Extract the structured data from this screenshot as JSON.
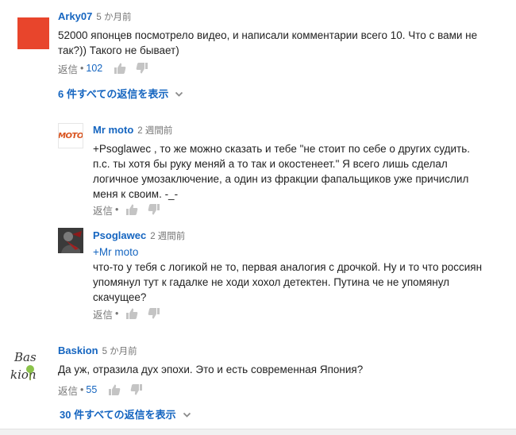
{
  "comments": [
    {
      "author": "Arky07",
      "time": "5 か月前",
      "text": "52000 японцев посмотрело видео, и написали комментарии всего 10. Что с вами не так?)) Такого не бывает)",
      "reply_label": "返信",
      "likes": "102",
      "avatar": {
        "icon": "red-square-avatar",
        "color": "#e8452c"
      },
      "view_replies": "6 件すべての返信を表示"
    },
    {
      "author": "Baskion",
      "time": "5 か月前",
      "text": "Да уж, отразила дух эпохи. Это и есть современная Япония?",
      "reply_label": "返信",
      "likes": "55",
      "avatar": {
        "icon": "handwritten-baskion-avatar",
        "lines": [
          "Bas",
          "kion"
        ]
      },
      "view_replies": "30 件すべての返信を表示"
    }
  ],
  "replies": [
    {
      "author": "Mr moto",
      "time": "2 週間前",
      "text": "+Psoglawec , то же можно сказать и тебе \"не стоит по себе о других судить. п.с. ты хотя бы руку меняй а то так и окостенеет.\" Я всего лишь сделал логичное умозаключение, а один из фракции фапальщиков уже причислил меня к своим. -_-",
      "reply_label": "返信",
      "avatar": {
        "icon": "moto-logo-avatar",
        "label": "MOTO",
        "color": "#d9531e"
      }
    },
    {
      "author": "Psoglawec",
      "time": "2 週間前",
      "mention": "+Mr moto",
      "text": "что-то у тебя с логикой не то, первая аналогия с дрочкой. Ну и то что россиян упомянул тут к гадалке не ходи хохол детектен. Путина че не упомянул скачущее?",
      "reply_label": "返信",
      "avatar": {
        "icon": "dark-figure-avatar"
      }
    }
  ],
  "icons": {
    "like": "thumbs-up-icon",
    "dislike": "thumbs-down-icon",
    "expand": "chevron-down-icon"
  },
  "colors": {
    "link": "#1565c0",
    "meta": "#767676",
    "text": "#222222"
  }
}
